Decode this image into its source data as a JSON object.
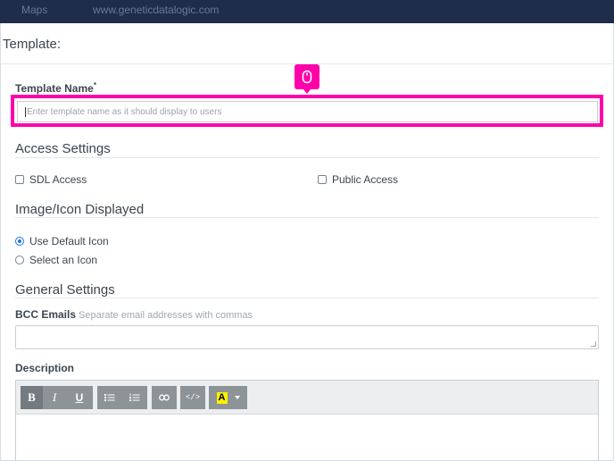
{
  "topbar": {
    "item1": "Maps",
    "item2": "www.geneticdatalogic.com"
  },
  "modal": {
    "title": "Template:"
  },
  "template_name": {
    "label": "Template Name",
    "required_mark": "*",
    "placeholder": "Enter template name as it should display to users",
    "value": ""
  },
  "pin_icon": "mouse-click-icon",
  "highlight_color": "#ff00aa",
  "access_settings": {
    "title": "Access Settings",
    "sdl_label": "SDL Access",
    "sdl_checked": false,
    "public_label": "Public Access",
    "public_checked": false
  },
  "image_icon": {
    "title": "Image/Icon Displayed",
    "options": [
      {
        "label": "Use Default Icon",
        "selected": true
      },
      {
        "label": "Select an Icon",
        "selected": false
      }
    ]
  },
  "general_settings": {
    "title": "General Settings",
    "bcc_label": "BCC Emails",
    "bcc_hint": "Separate email addresses with commas",
    "bcc_value": "",
    "description_label": "Description"
  },
  "editor_toolbar": {
    "bold": "B",
    "italic": "I",
    "underline": "U",
    "unordered_list_icon": "bullet-list-icon",
    "ordered_list_icon": "numbered-list-icon",
    "link_icon": "link-icon",
    "code": "</>",
    "highlight": "A"
  }
}
